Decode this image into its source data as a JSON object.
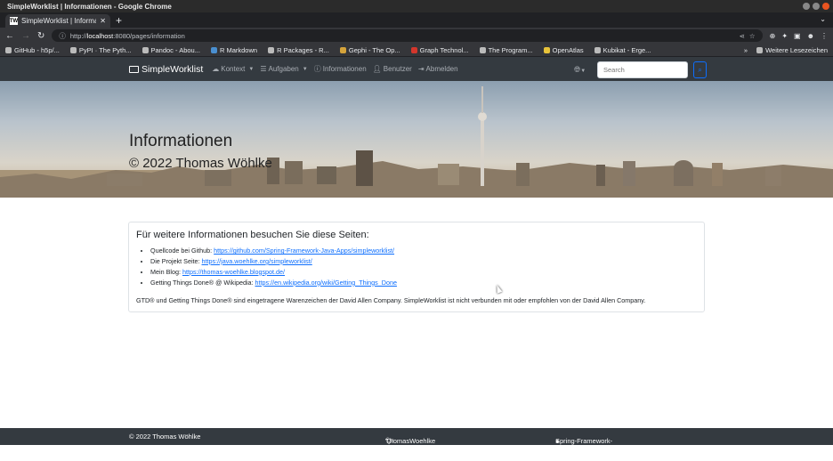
{
  "window": {
    "title": "SimpleWorklist | Informationen - Google Chrome"
  },
  "tab": {
    "title": "SimpleWorklist | Informat",
    "favicon": "TW"
  },
  "address": {
    "prefix": "http://",
    "host": "localhost",
    "rest": ":8080/pages/information"
  },
  "bookmarks": [
    {
      "label": "GitHub - h5p/...",
      "icon": "github-icon"
    },
    {
      "label": "PyPI · The Pyth...",
      "icon": "pypi-icon"
    },
    {
      "label": "Pandoc - Abou...",
      "icon": "pandoc-icon"
    },
    {
      "label": "R Markdown",
      "icon": "rmarkdown-icon"
    },
    {
      "label": "R Packages - R...",
      "icon": "rpackages-icon"
    },
    {
      "label": "Gephi - The Op...",
      "icon": "gephi-icon"
    },
    {
      "label": "Graph Technol...",
      "icon": "graph-icon"
    },
    {
      "label": "The Program...",
      "icon": "program-icon"
    },
    {
      "label": "OpenAtlas",
      "icon": "openatlas-icon"
    },
    {
      "label": "Kubikat - Erge...",
      "icon": "kubikat-icon"
    }
  ],
  "bookmarks_more": "»",
  "bookmarks_folder": "Weitere Lesezeichen",
  "nav": {
    "brand": "SimpleWorklist",
    "items": [
      "Kontext",
      "Aufgaben",
      "Informationen",
      "Benutzer",
      "Abmelden"
    ],
    "search_placeholder": "Search"
  },
  "hero": {
    "title": "Informationen",
    "subtitle": "© 2022 Thomas Wöhlke"
  },
  "card": {
    "heading": "Für weitere Informationen besuchen Sie diese Seiten:",
    "links": [
      {
        "text": "Quellcode bei Github: ",
        "url": "https://github.com/Spring-Framework-Java-Apps/simpleworklist/"
      },
      {
        "text": "Die Projekt Seite: ",
        "url": "https://java.woehlke.org/simpleworklist/"
      },
      {
        "text": "Mein Blog: ",
        "url": "https://thomas-woehlke.blogspot.de/"
      },
      {
        "text": "Getting Things Done® @ Wikipedia: ",
        "url": "https://en.wikipedia.org/wiki/Getting_Things_Done"
      }
    ],
    "note": "GTD® und Getting Things Done® sind eingetragene Warenzeichen der David Allen Company. SimpleWorklist ist nicht verbunden mit oder empfohlen von der David Allen Company."
  },
  "footer": {
    "copyright": "© 2022 Thomas Wöhlke",
    "twitter": "ThomasWoehlke",
    "github": "Spring-Framework-Java-Apps/simpleworklist"
  }
}
